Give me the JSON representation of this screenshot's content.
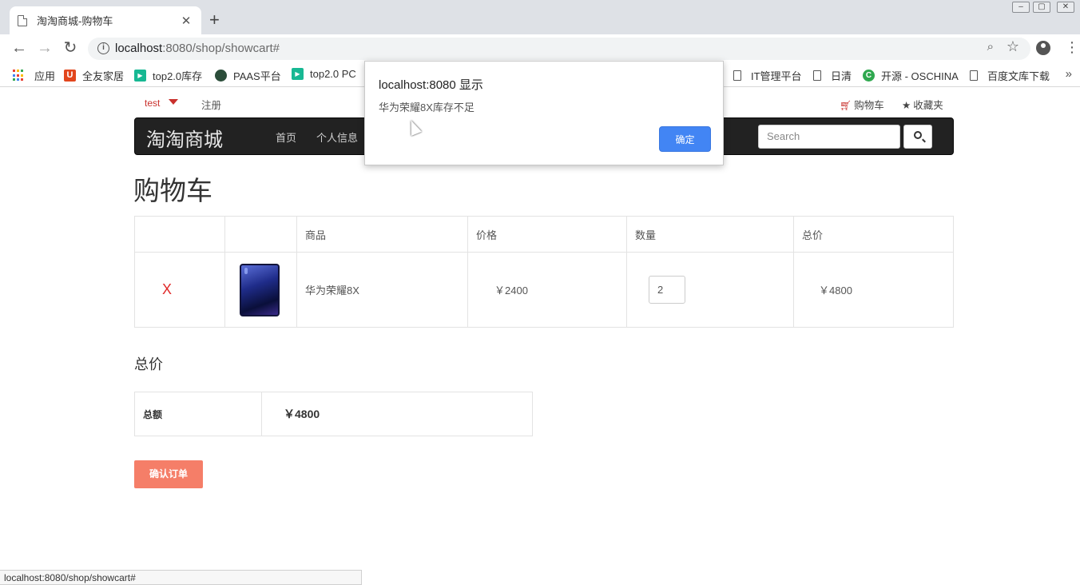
{
  "browser": {
    "tab_title": "淘淘商城-购物车",
    "tab_close": "✕",
    "new_tab": "+",
    "window_controls": [
      "–",
      "▢",
      "✕"
    ],
    "url_host": "localhost",
    "url_rest": ":8080/shop/showcart#",
    "bookmarks": [
      {
        "label": "应用",
        "icon": "apps-grid-icon"
      },
      {
        "label": "全友家居",
        "icon": "quanyou-icon",
        "color": "#e2461d"
      },
      {
        "label": "top2.0库存",
        "icon": "play-green-icon",
        "color": "#17b893"
      },
      {
        "label": "PAAS平台",
        "icon": "paas-globe-icon",
        "color": "#2b4d3a"
      },
      {
        "label": "top2.0 PC",
        "icon": "play-green-icon",
        "color": "#17b893"
      },
      {
        "label": "IT管理平台",
        "icon": "doc-icon"
      },
      {
        "label": "日清",
        "icon": "doc-icon"
      },
      {
        "label": "开源 - OSCHINA",
        "icon": "oschina-icon",
        "color": "#2fa84f"
      },
      {
        "label": "百度文库下载",
        "icon": "doc-icon"
      }
    ],
    "bookmarks_more": "»",
    "status_url": "localhost:8080/shop/showcart#"
  },
  "site": {
    "user": "test",
    "register": "注册",
    "cart_link": "购物车",
    "favorites_link": "收藏夹",
    "brand": "淘淘商城",
    "nav": [
      "首页",
      "个人信息"
    ],
    "search_placeholder": "Search"
  },
  "cart": {
    "title": "购物车",
    "headers": [
      "",
      "",
      "商品",
      "价格",
      "数量",
      "总价"
    ],
    "items": [
      {
        "remove": "X",
        "name": "华为荣耀8X",
        "price": "￥2400",
        "quantity": "2",
        "subtotal": "￥4800"
      }
    ],
    "total_heading": "总价",
    "total_label": "总额",
    "total_amount": "￥4800",
    "confirm": "确认订单"
  },
  "dialog": {
    "title": "localhost:8080 显示",
    "message": "华为荣耀8X库存不足",
    "ok": "确定"
  },
  "colors": {
    "accent_red": "#c9302c",
    "confirm_button": "#f57e68",
    "dialog_ok": "#4285f4",
    "navbar": "#222222"
  }
}
